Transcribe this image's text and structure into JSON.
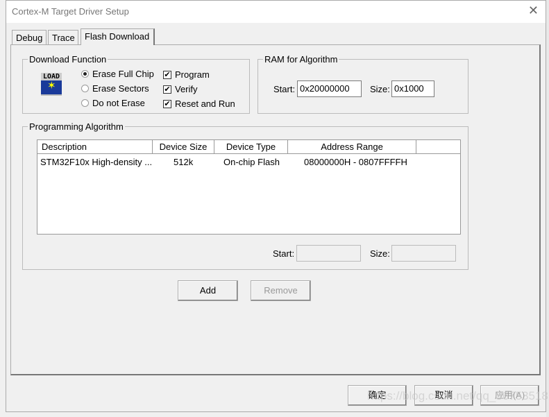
{
  "window": {
    "title": "Cortex-M Target Driver Setup"
  },
  "tabs": [
    {
      "label": "Debug"
    },
    {
      "label": "Trace"
    },
    {
      "label": "Flash Download",
      "active": true
    }
  ],
  "download_function": {
    "label": "Download Function",
    "icon": "load-icon",
    "icon_text": "LOAD",
    "radios": [
      {
        "label": "Erase Full Chip",
        "checked": true
      },
      {
        "label": "Erase Sectors",
        "checked": false
      },
      {
        "label": "Do not Erase",
        "checked": false
      }
    ],
    "checkboxes": [
      {
        "label": "Program",
        "checked": true
      },
      {
        "label": "Verify",
        "checked": true
      },
      {
        "label": "Reset and Run",
        "checked": true
      }
    ]
  },
  "ram": {
    "label": "RAM for Algorithm",
    "start_label": "Start:",
    "start": "0x20000000",
    "size_label": "Size:",
    "size": "0x1000"
  },
  "algorithm": {
    "label": "Programming Algorithm",
    "columns": [
      "Description",
      "Device Size",
      "Device Type",
      "Address Range"
    ],
    "rows": [
      [
        "STM32F10x High-density ...",
        "512k",
        "On-chip Flash",
        "08000000H - 0807FFFFH"
      ]
    ],
    "start_label": "Start:",
    "start": "",
    "size_label": "Size:",
    "size": ""
  },
  "buttons": {
    "add": "Add",
    "remove": "Remove",
    "ok": "确定",
    "cancel": "取消",
    "apply": "应用(A)"
  },
  "watermark": "https://blog.csdn.net/qq_36753518"
}
